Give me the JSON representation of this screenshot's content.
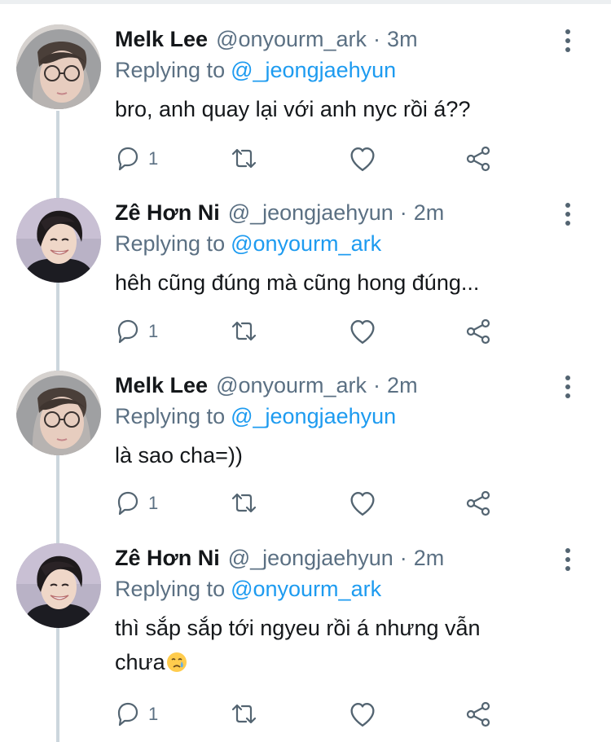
{
  "tweets": [
    {
      "name": "Melk Lee",
      "handle": "@onyourm_ark",
      "time": "3m",
      "replying_prefix": "Replying to",
      "replying_to": "@_jeongjaehyun",
      "text": "bro, anh quay lại với anh nyc rồi á??",
      "reply_count": "1",
      "avatar": "gray-hoodie-glasses"
    },
    {
      "name": "Zê Hơn Ni",
      "handle": "@_jeongjaehyun",
      "time": "2m",
      "replying_prefix": "Replying to",
      "replying_to": "@onyourm_ark",
      "text": "hêh cũng đúng mà cũng hong đúng...",
      "reply_count": "1",
      "avatar": "smiling-dark-hair"
    },
    {
      "name": "Melk Lee",
      "handle": "@onyourm_ark",
      "time": "2m",
      "replying_prefix": "Replying to",
      "replying_to": "@_jeongjaehyun",
      "text": "là sao cha=))",
      "reply_count": "1",
      "avatar": "gray-hoodie-glasses"
    },
    {
      "name": "Zê Hơn Ni",
      "handle": "@_jeongjaehyun",
      "time": "2m",
      "replying_prefix": "Replying to",
      "replying_to": "@onyourm_ark",
      "text_line1": "thì sắp sắp tới ngyeu rồi á nhưng vẫn",
      "text_line2": "chưa",
      "emoji": "crying-face-emoji",
      "reply_count": "1",
      "avatar": "smiling-dark-hair"
    }
  ],
  "separator": "·",
  "colors": {
    "accent": "#1d9bf0",
    "secondary_text": "#5b7083",
    "primary_text": "#14171a",
    "icon": "#536471",
    "thread_line": "#ccd6dd"
  },
  "icons": [
    "reply-icon",
    "retweet-icon",
    "like-icon",
    "share-icon",
    "more-options-icon"
  ]
}
